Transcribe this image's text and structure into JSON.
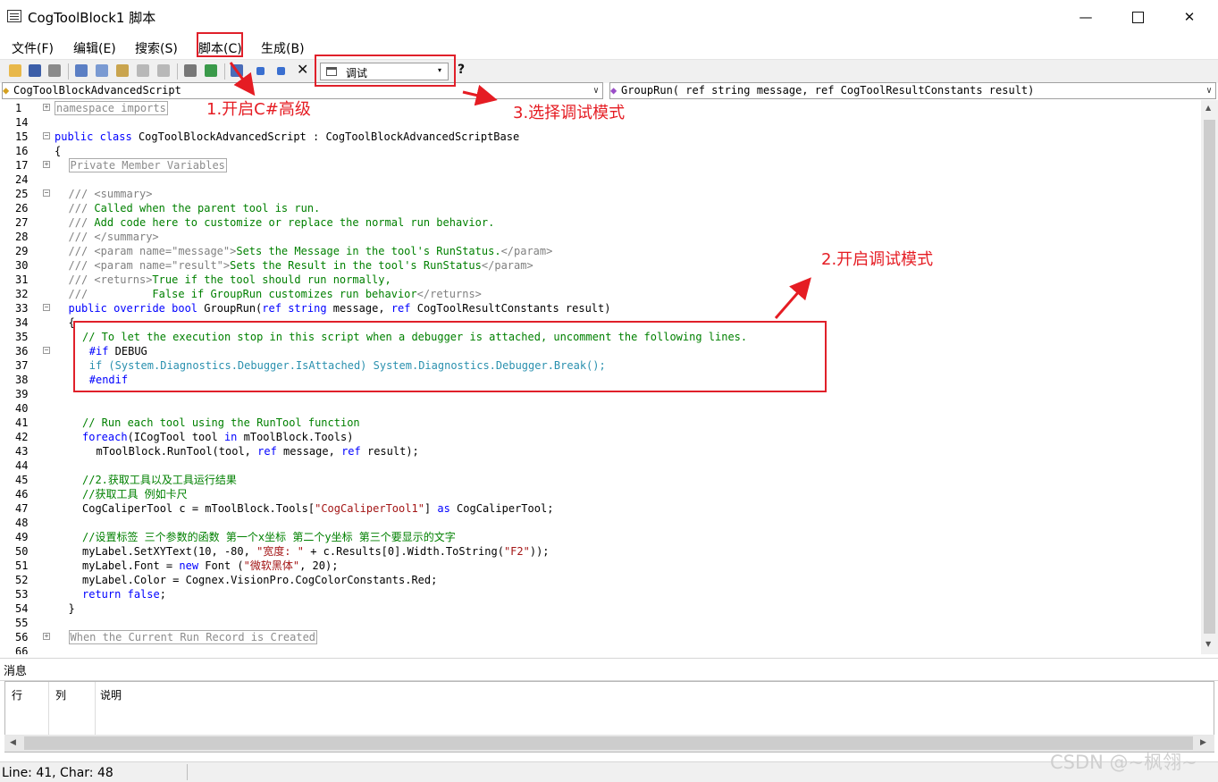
{
  "window": {
    "title": "CogToolBlock1 脚本",
    "minimize": "—",
    "close": "✕"
  },
  "menu": [
    "文件(F)",
    "编辑(E)",
    "搜索(S)",
    "脚本(C)",
    "生成(B)"
  ],
  "toolbar": {
    "mode_value": "调试",
    "dropdown_arrow": "▾",
    "help": "?",
    "delete": "✕"
  },
  "nav": {
    "class_value": "CogToolBlockAdvancedScript",
    "method_value": "GroupRun( ref string message,  ref CogToolResultConstants result)",
    "arrow": "∨"
  },
  "code_lines": [
    {
      "n": "1",
      "fold": "+",
      "indent": 0,
      "parts": [
        {
          "t": "namespace imports",
          "c": "collapsed"
        }
      ]
    },
    {
      "n": "14",
      "indent": 0,
      "parts": []
    },
    {
      "n": "15",
      "fold": "−",
      "indent": 0,
      "parts": [
        {
          "t": "public",
          "c": "kw"
        },
        {
          "t": " "
        },
        {
          "t": "class",
          "c": "kw"
        },
        {
          "t": " CogToolBlockAdvancedScript : CogToolBlockAdvancedScriptBase"
        }
      ]
    },
    {
      "n": "16",
      "indent": 0,
      "parts": [
        {
          "t": "{"
        }
      ]
    },
    {
      "n": "17",
      "fold": "+",
      "indent": 2,
      "parts": [
        {
          "t": "Private Member Variables",
          "c": "collapsed"
        }
      ]
    },
    {
      "n": "24",
      "indent": 0,
      "parts": []
    },
    {
      "n": "25",
      "fold": "−",
      "indent": 2,
      "parts": [
        {
          "t": "/// <summary>",
          "c": "gr"
        }
      ]
    },
    {
      "n": "26",
      "indent": 2,
      "parts": [
        {
          "t": "/// ",
          "c": "gr"
        },
        {
          "t": "Called when the parent tool is run.",
          "c": "cm"
        }
      ]
    },
    {
      "n": "27",
      "indent": 2,
      "parts": [
        {
          "t": "/// ",
          "c": "gr"
        },
        {
          "t": "Add code here to customize or replace the normal run behavior.",
          "c": "cm"
        }
      ]
    },
    {
      "n": "28",
      "indent": 2,
      "parts": [
        {
          "t": "/// </summary>",
          "c": "gr"
        }
      ]
    },
    {
      "n": "29",
      "indent": 2,
      "parts": [
        {
          "t": "/// <param name=\"message\">",
          "c": "gr"
        },
        {
          "t": "Sets the Message in the tool's RunStatus.",
          "c": "cm"
        },
        {
          "t": "</param>",
          "c": "gr"
        }
      ]
    },
    {
      "n": "30",
      "indent": 2,
      "parts": [
        {
          "t": "/// <param name=\"result\">",
          "c": "gr"
        },
        {
          "t": "Sets the Result in the tool's RunStatus",
          "c": "cm"
        },
        {
          "t": "</param>",
          "c": "gr"
        }
      ]
    },
    {
      "n": "31",
      "indent": 2,
      "parts": [
        {
          "t": "/// <returns>",
          "c": "gr"
        },
        {
          "t": "True if the tool should run normally,",
          "c": "cm"
        }
      ]
    },
    {
      "n": "32",
      "indent": 2,
      "parts": [
        {
          "t": "///          ",
          "c": "gr"
        },
        {
          "t": "False if GroupRun customizes run behavior",
          "c": "cm"
        },
        {
          "t": "</returns>",
          "c": "gr"
        }
      ]
    },
    {
      "n": "33",
      "fold": "−",
      "indent": 2,
      "parts": [
        {
          "t": "public",
          "c": "kw"
        },
        {
          "t": " "
        },
        {
          "t": "override",
          "c": "kw"
        },
        {
          "t": " "
        },
        {
          "t": "bool",
          "c": "kw"
        },
        {
          "t": " GroupRun("
        },
        {
          "t": "ref",
          "c": "kw"
        },
        {
          "t": " "
        },
        {
          "t": "string",
          "c": "kw"
        },
        {
          "t": " message, "
        },
        {
          "t": "ref",
          "c": "kw"
        },
        {
          "t": " CogToolResultConstants result)"
        }
      ]
    },
    {
      "n": "34",
      "indent": 2,
      "parts": [
        {
          "t": "{"
        }
      ]
    },
    {
      "n": "35",
      "indent": 4,
      "parts": [
        {
          "t": "// To let the execution stop in this script when a debugger is attached, uncomment the following lines.",
          "c": "cm"
        }
      ]
    },
    {
      "n": "36",
      "fold": "−",
      "indent": 5,
      "parts": [
        {
          "t": "#if",
          "c": "kw"
        },
        {
          "t": " DEBUG"
        }
      ]
    },
    {
      "n": "37",
      "indent": 5,
      "parts": [
        {
          "t": "if (System.Diagnostics.Debugger.IsAttached) System.Diagnostics.Debugger.Break();",
          "c": "tl"
        }
      ]
    },
    {
      "n": "38",
      "indent": 5,
      "parts": [
        {
          "t": "#endif",
          "c": "kw"
        }
      ]
    },
    {
      "n": "39",
      "indent": 0,
      "parts": []
    },
    {
      "n": "40",
      "indent": 0,
      "parts": []
    },
    {
      "n": "41",
      "indent": 4,
      "parts": [
        {
          "t": "// Run each tool using the RunTool function",
          "c": "cm"
        }
      ]
    },
    {
      "n": "42",
      "indent": 4,
      "parts": [
        {
          "t": "foreach",
          "c": "kw"
        },
        {
          "t": "(ICogTool tool "
        },
        {
          "t": "in",
          "c": "kw"
        },
        {
          "t": " mToolBlock.Tools)"
        }
      ]
    },
    {
      "n": "43",
      "indent": 6,
      "parts": [
        {
          "t": "mToolBlock.RunTool(tool, "
        },
        {
          "t": "ref",
          "c": "kw"
        },
        {
          "t": " message, "
        },
        {
          "t": "ref",
          "c": "kw"
        },
        {
          "t": " result);"
        }
      ]
    },
    {
      "n": "44",
      "indent": 0,
      "parts": []
    },
    {
      "n": "45",
      "indent": 4,
      "parts": [
        {
          "t": "//2.获取工具以及工具运行结果",
          "c": "cm"
        }
      ]
    },
    {
      "n": "46",
      "indent": 4,
      "parts": [
        {
          "t": "//获取工具 例如卡尺",
          "c": "cm"
        }
      ]
    },
    {
      "n": "47",
      "indent": 4,
      "parts": [
        {
          "t": "CogCaliperTool c = mToolBlock.Tools["
        },
        {
          "t": "\"CogCaliperTool1\"",
          "c": "str"
        },
        {
          "t": "] "
        },
        {
          "t": "as",
          "c": "kw"
        },
        {
          "t": " CogCaliperTool;"
        }
      ]
    },
    {
      "n": "48",
      "indent": 0,
      "parts": []
    },
    {
      "n": "49",
      "indent": 4,
      "parts": [
        {
          "t": "//设置标签 三个参数的函数 第一个x坐标 第二个y坐标 第三个要显示的文字",
          "c": "cm"
        }
      ]
    },
    {
      "n": "50",
      "indent": 4,
      "parts": [
        {
          "t": "myLabel.SetXYText(10, -80, "
        },
        {
          "t": "\"宽度: \"",
          "c": "str"
        },
        {
          "t": " + c.Results[0].Width.ToString("
        },
        {
          "t": "\"F2\"",
          "c": "str"
        },
        {
          "t": "));"
        }
      ]
    },
    {
      "n": "51",
      "indent": 4,
      "parts": [
        {
          "t": "myLabel.Font = "
        },
        {
          "t": "new",
          "c": "kw"
        },
        {
          "t": " Font ("
        },
        {
          "t": "\"微软黑体\"",
          "c": "str"
        },
        {
          "t": ", 20);"
        }
      ]
    },
    {
      "n": "52",
      "indent": 4,
      "parts": [
        {
          "t": "myLabel.Color = Cognex.VisionPro.CogColorConstants.Red;"
        }
      ]
    },
    {
      "n": "53",
      "indent": 4,
      "parts": [
        {
          "t": "return",
          "c": "kw"
        },
        {
          "t": " "
        },
        {
          "t": "false",
          "c": "kw"
        },
        {
          "t": ";"
        }
      ]
    },
    {
      "n": "54",
      "indent": 2,
      "parts": [
        {
          "t": "}"
        }
      ]
    },
    {
      "n": "55",
      "indent": 0,
      "parts": []
    },
    {
      "n": "56",
      "fold": "+",
      "indent": 2,
      "parts": [
        {
          "t": "When the Current Run Record is Created",
          "c": "collapsed"
        }
      ]
    },
    {
      "n": "66",
      "indent": 0,
      "parts": []
    }
  ],
  "messages": {
    "tab_label": "消息",
    "columns": [
      "行",
      "列",
      "说明"
    ]
  },
  "status": {
    "position": "Line: 41, Char: 48"
  },
  "watermark": "CSDN @~枫翎~",
  "annotations": {
    "step1": "1.开启C#高级",
    "step2": "2.开启调试模式",
    "step3": "3.选择调试模式",
    "color": "#e51c23"
  }
}
